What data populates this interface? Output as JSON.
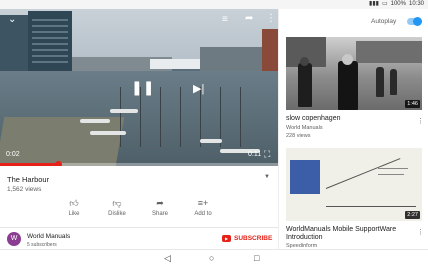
{
  "status_bar": {
    "battery": "100%",
    "time": "10:30"
  },
  "player": {
    "current_time": "0:02",
    "total_time": "0:11",
    "progress": 0.21
  },
  "video": {
    "title": "The Harbour",
    "views": "1,562 views"
  },
  "actions": {
    "like": "Like",
    "dislike": "Dislike",
    "share": "Share",
    "add_to": "Add to"
  },
  "channel": {
    "avatar_letter": "W",
    "name": "World Manuals",
    "subscribers": "5 subscribers",
    "subscribe_label": "SUBSCRIBE"
  },
  "sidebar": {
    "autoplay_label": "Autoplay",
    "autoplay_on": true,
    "related": [
      {
        "title": "slow copenhagen",
        "channel": "World Manuals",
        "views": "228 views",
        "duration": "1:46"
      },
      {
        "title": "WorldManuals Mobile SupportWare Introduction",
        "channel": "Speedinform",
        "views": "",
        "duration": "2:27"
      }
    ]
  },
  "colors": {
    "accent_red": "#e62117",
    "toggle_blue": "#2196f3",
    "avatar_purple": "#8a3d91"
  },
  "icons": {
    "collapse": "chevron-down-icon",
    "add_to_queue": "playlist-add-icon",
    "share": "share-icon",
    "more": "more-vert-icon",
    "pause": "pause-icon",
    "next": "skip-next-icon",
    "fullscreen": "fullscreen-icon"
  }
}
